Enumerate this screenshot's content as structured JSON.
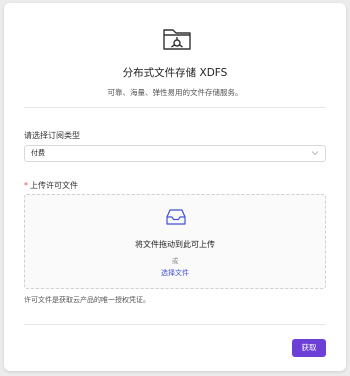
{
  "header": {
    "icon": "folder-network-icon",
    "title": "分布式文件存储 XDFS",
    "subtitle": "可靠、海量、弹性易用的文件存储服务。"
  },
  "subscription": {
    "label": "请选择订阅类型",
    "selected": "付费"
  },
  "upload": {
    "required_mark": "*",
    "label": "上传许可文件",
    "icon": "inbox-icon",
    "drag_text": "将文件拖动到此可上传",
    "or_text": "或",
    "select_link": "选择文件",
    "hint": "许可文件是获取云产品的唯一授权凭证。"
  },
  "actions": {
    "submit_label": "获取"
  },
  "colors": {
    "accent": "#6c3fd6",
    "link": "#3f51d6",
    "required": "#e5484d"
  }
}
